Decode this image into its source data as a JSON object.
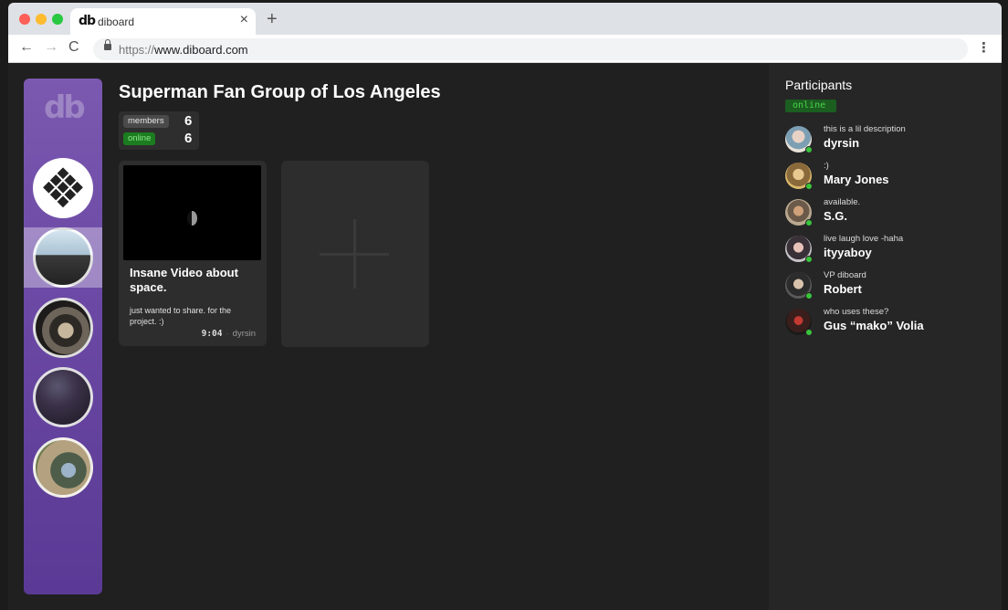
{
  "browser": {
    "tab_logo": "db",
    "tab_title": "diboard",
    "tab_close": "×",
    "new_tab": "+",
    "url_protocol": "https://",
    "url_host": "www.diboard.com",
    "nav_back": "←",
    "nav_forward": "→",
    "nav_reload": "C",
    "menu": "⋮"
  },
  "sidebar": {
    "logo": "db",
    "groups": [
      {
        "icon": "cube-group-icon"
      },
      {
        "icon": "superman-group-icon",
        "active": true
      },
      {
        "icon": "car-interior-group-icon"
      },
      {
        "icon": "night-sky-group-icon"
      },
      {
        "icon": "phone-group-icon"
      }
    ]
  },
  "group": {
    "title": "Superman Fan Group of Los Angeles",
    "members_label": "members",
    "members_count": "6",
    "online_label": "online",
    "online_count": "6"
  },
  "posts": [
    {
      "title": "Insane Video about space.",
      "description": "just wanted to share. for the project. :)",
      "time": "9:04",
      "author": "dyrsin"
    }
  ],
  "participants": {
    "title": "Participants",
    "filter": "online",
    "people": [
      {
        "desc": "this is a lil description",
        "name": "dyrsin"
      },
      {
        "desc": ":)",
        "name": "Mary Jones"
      },
      {
        "desc": "available.",
        "name": "S.G."
      },
      {
        "desc": "live laugh love -haha",
        "name": "ityyaboy"
      },
      {
        "desc": "VP diboard",
        "name": "Robert"
      },
      {
        "desc": "who uses these?",
        "name": "Gus “mako” Volia"
      }
    ]
  },
  "colors": {
    "sidebar_top": "#7b59b0",
    "sidebar_bottom": "#5a3a95",
    "online_green": "#39c43b",
    "background": "#202020"
  }
}
